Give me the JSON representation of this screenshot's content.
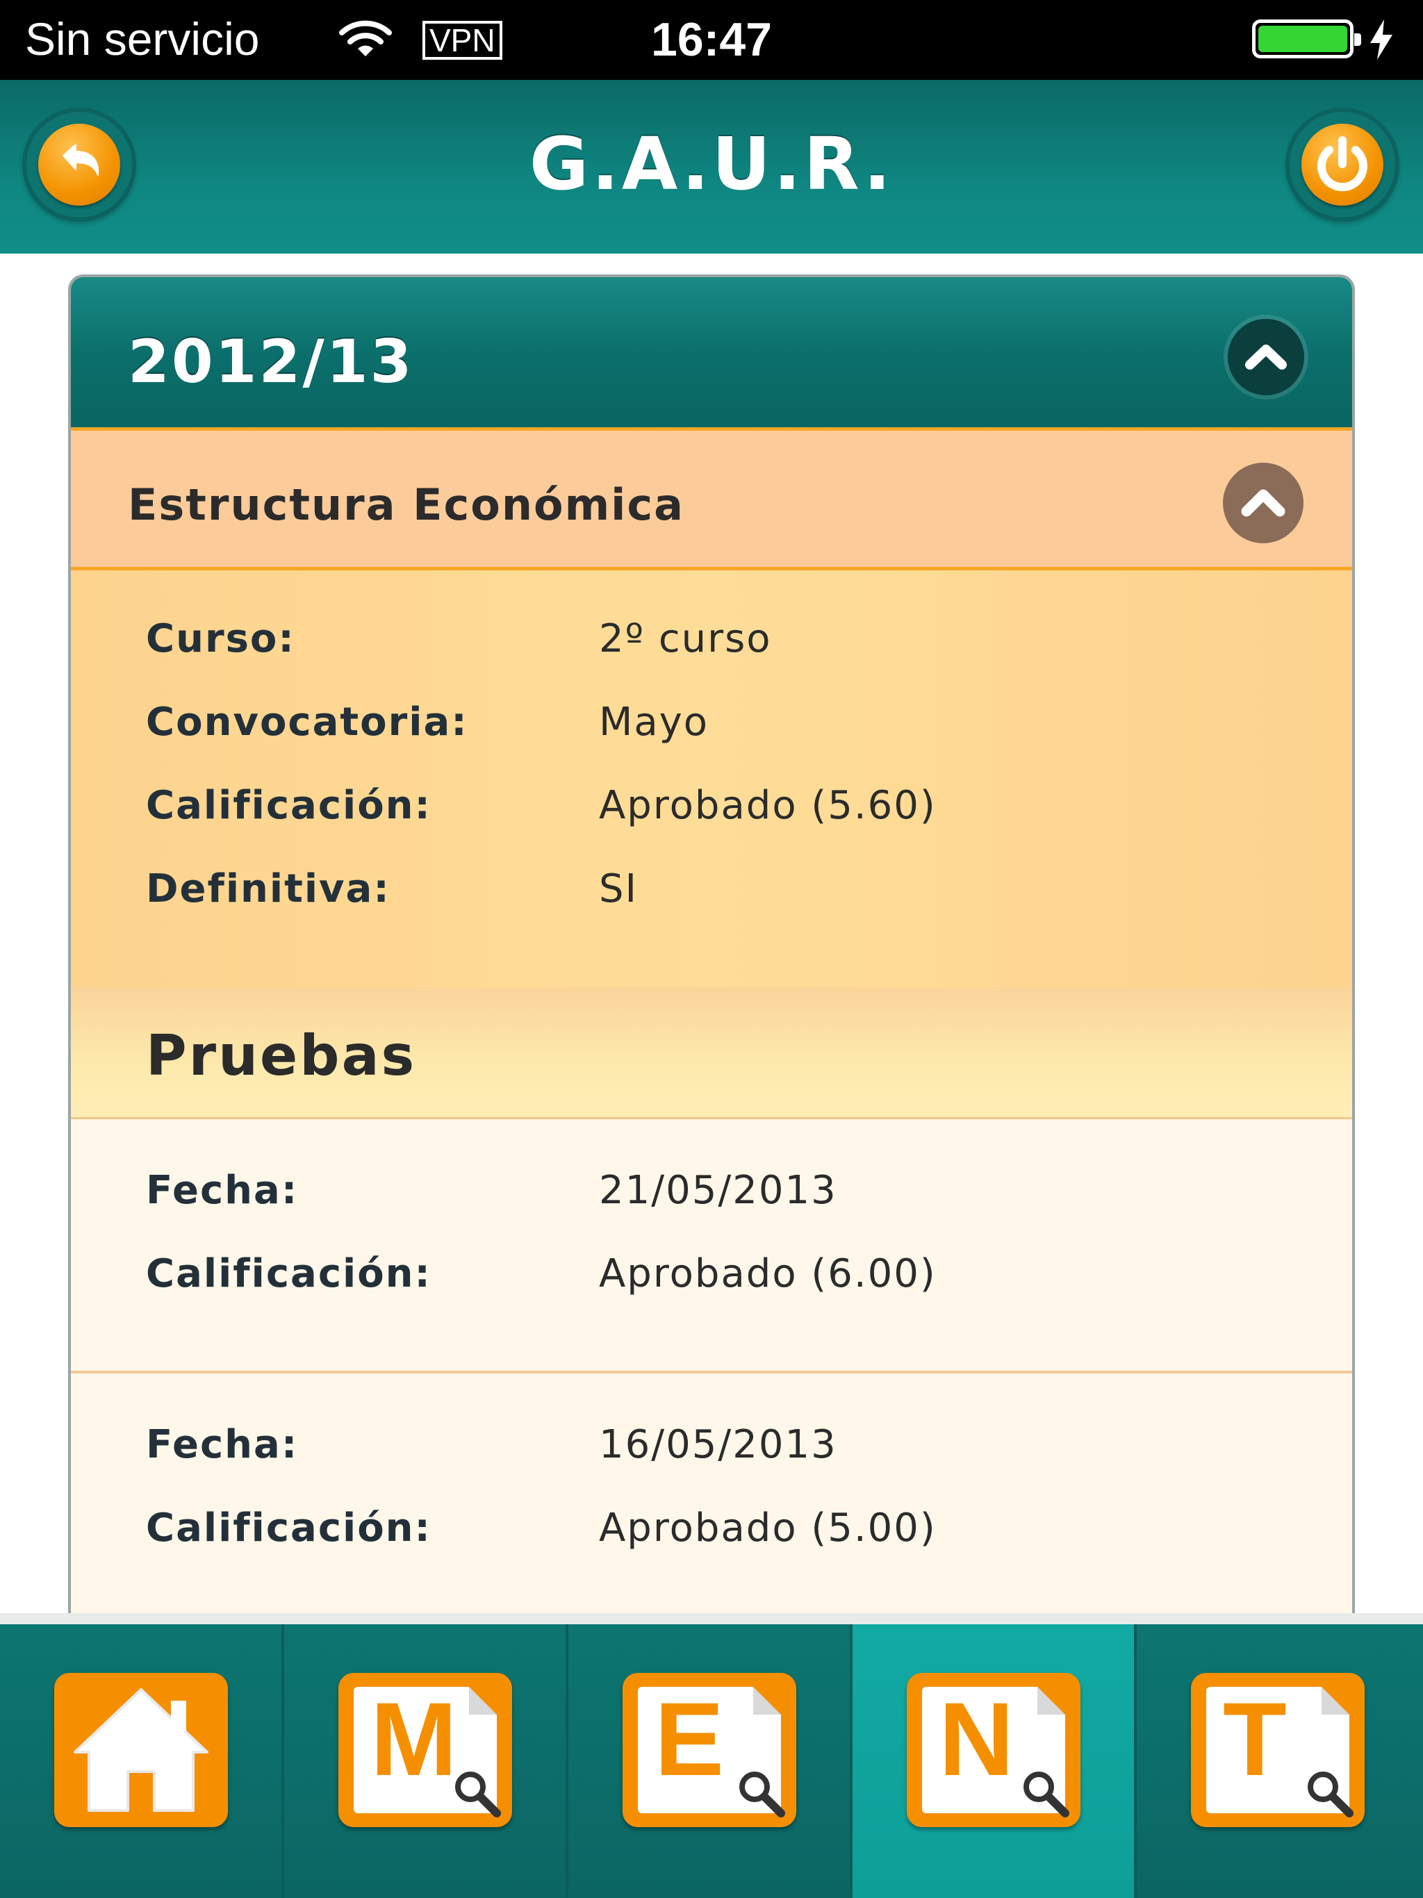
{
  "status_bar": {
    "carrier": "Sin servicio",
    "vpn": "VPN",
    "time": "16:47",
    "battery_level": 1.0
  },
  "nav": {
    "title": "G.A.U.R.",
    "back_icon": "back-arrow-icon",
    "power_icon": "power-icon"
  },
  "year": {
    "title": "2012/13"
  },
  "subject": {
    "title": "Estructura Económica"
  },
  "details": [
    {
      "label": "Curso:",
      "value": "2º curso"
    },
    {
      "label": "Convocatoria:",
      "value": "Mayo"
    },
    {
      "label": "Calificación:",
      "value": "Aprobado (5.60)"
    },
    {
      "label": "Definitiva:",
      "value": "SI"
    }
  ],
  "pruebas": {
    "title": "Pruebas",
    "items": [
      {
        "fecha_label": "Fecha:",
        "fecha": "21/05/2013",
        "calif_label": "Calificación:",
        "calif": "Aprobado (6.00)"
      },
      {
        "fecha_label": "Fecha:",
        "fecha": "16/05/2013",
        "calif_label": "Calificación:",
        "calif": "Aprobado (5.00)"
      }
    ]
  },
  "tabs": [
    {
      "name": "home",
      "icon": "home-icon",
      "letter": ""
    },
    {
      "name": "m",
      "icon": "document-search-icon",
      "letter": "M"
    },
    {
      "name": "e",
      "icon": "document-search-icon",
      "letter": "E"
    },
    {
      "name": "n",
      "icon": "document-search-icon",
      "letter": "N",
      "active": true
    },
    {
      "name": "t",
      "icon": "document-search-icon",
      "letter": "T"
    }
  ],
  "colors": {
    "teal": "#0b6c68",
    "active_tab": "#12aaa3",
    "orange": "#f58f00",
    "subject_bg": "#fccb9a",
    "details_bg": "#fedd98"
  }
}
